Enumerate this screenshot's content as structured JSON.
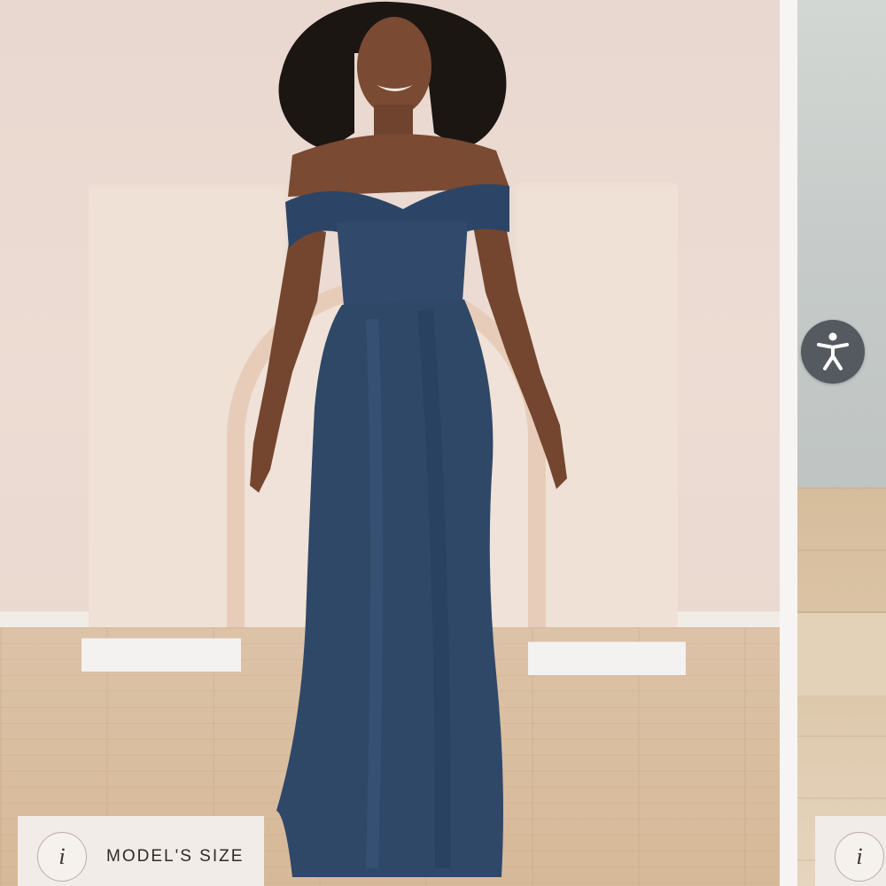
{
  "product_gallery": {
    "current_slide": {
      "photo": "model-in-navy-off-shoulder-satin-gown",
      "size_badge": {
        "icon": "info-icon",
        "icon_glyph": "i",
        "label": "MODEL'S SIZE"
      }
    },
    "next_slide": {
      "photo": "next-gallery-photo-preview",
      "size_badge": {
        "icon": "info-icon",
        "icon_glyph": "i"
      }
    }
  },
  "accessibility_widget": {
    "icon": "accessibility-person-icon"
  },
  "colors": {
    "dress": "#2f4868",
    "wall": "#ecdcd3",
    "badge_bg": "#f1ece7",
    "a11y_button": "#555a60"
  }
}
